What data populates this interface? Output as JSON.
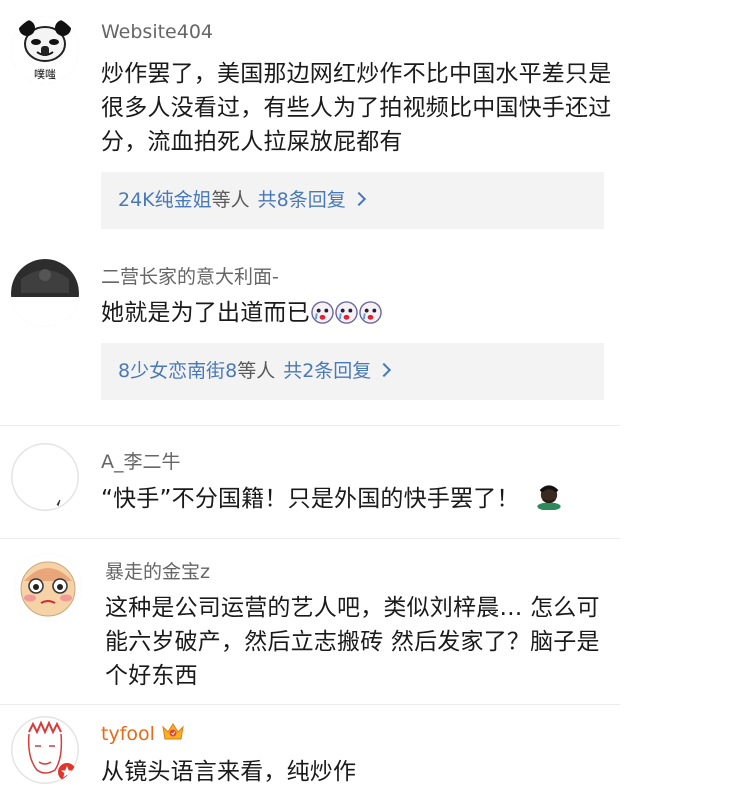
{
  "comments": [
    {
      "username": "Website404",
      "avatar_caption": "噗嗤",
      "text": "炒作罢了，美国那边网红炒作不比中国水平差只是很多人没看过，有些人为了拍视频比中国快手还过分，流血拍死人拉屎放屁都有",
      "reply": {
        "names": "24K纯金姐",
        "mid": "等人",
        "count": "共8条回复"
      }
    },
    {
      "username": "二营长家的意大利面-",
      "text": "她就是为了出道而已",
      "emojis": [
        "crying-face-icon",
        "crying-face-icon",
        "crying-face-icon"
      ],
      "reply": {
        "names": "8少女恋南街8",
        "mid": "等人",
        "count": "共2条回复"
      }
    },
    {
      "username": "A_李二牛",
      "text": "“快手”不分国籍！只是外国的快手罢了！",
      "emojis": [
        "facepalm-person-icon"
      ]
    },
    {
      "username": "暴走的金宝z",
      "text": "这种是公司运营的艺人吧，类似刘梓晨… 怎么可能六岁破产，然后立志搬砖 然后发家了？脑子是个好东西"
    },
    {
      "username": "tyfool",
      "vip_badge": "crown-vip-badge-icon",
      "text": "从镜头语言来看，纯炒作"
    }
  ],
  "colors": {
    "link": "#4a79b8",
    "vip_name": "#e86b17",
    "reply_bg": "#f3f3f3"
  }
}
